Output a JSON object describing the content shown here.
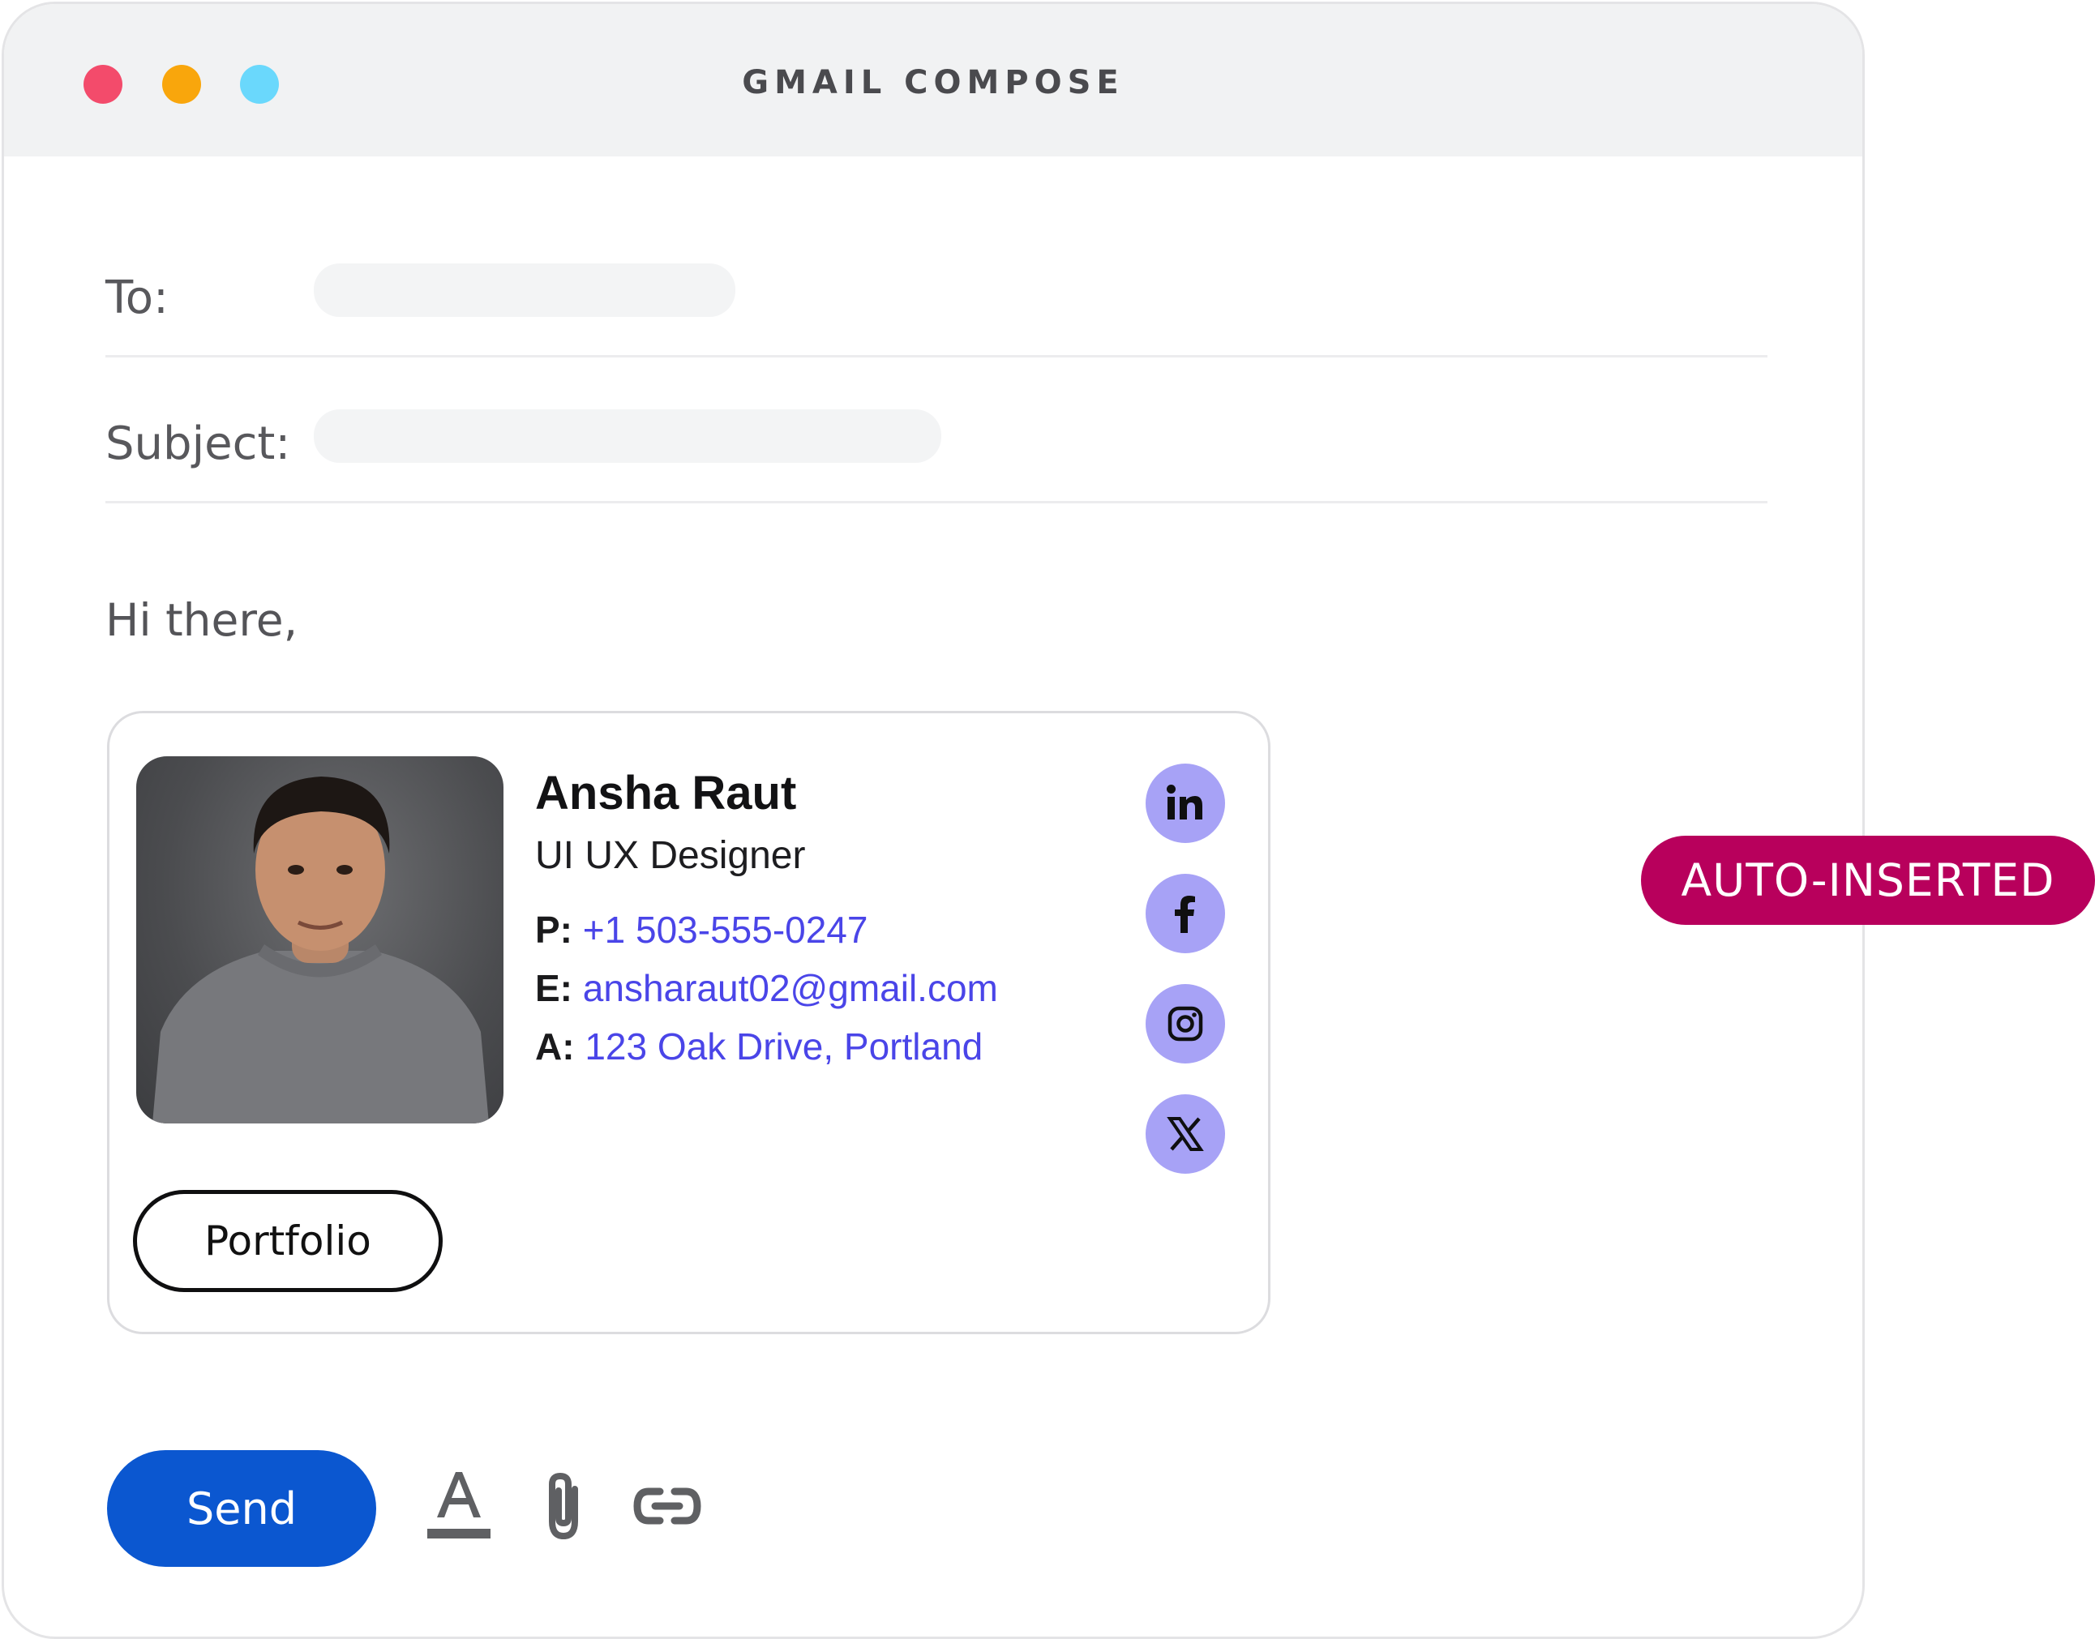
{
  "window": {
    "title": "GMAIL COMPOSE",
    "controls": {
      "close_color": "#f34b6b",
      "minimize_color": "#f9a60c",
      "maximize_color": "#6ad8fc"
    }
  },
  "compose": {
    "to_label": "To:",
    "to_value": "",
    "subject_label": "Subject:",
    "subject_value": "",
    "greeting": "Hi there,"
  },
  "signature": {
    "name": "Ansha Raut",
    "role": "UI UX Designer",
    "phone_label": "P:",
    "phone": "+1 503-555-0247",
    "email_label": "E:",
    "email": "ansharaut02@gmail.com",
    "address_label": "A:",
    "address": "123 Oak Drive, Portland",
    "portfolio_label": "Portfolio",
    "social": [
      "linkedin-icon",
      "facebook-icon",
      "instagram-icon",
      "x-icon"
    ],
    "social_color": "#a7a2f6",
    "link_color": "#4a45e8"
  },
  "toolbar": {
    "send_label": "Send",
    "send_color": "#0b57d0",
    "icons": [
      "text-format-icon",
      "attachment-icon",
      "link-icon"
    ]
  },
  "badge": {
    "label": "AUTO-INSERTED",
    "color": "#b8005c"
  }
}
